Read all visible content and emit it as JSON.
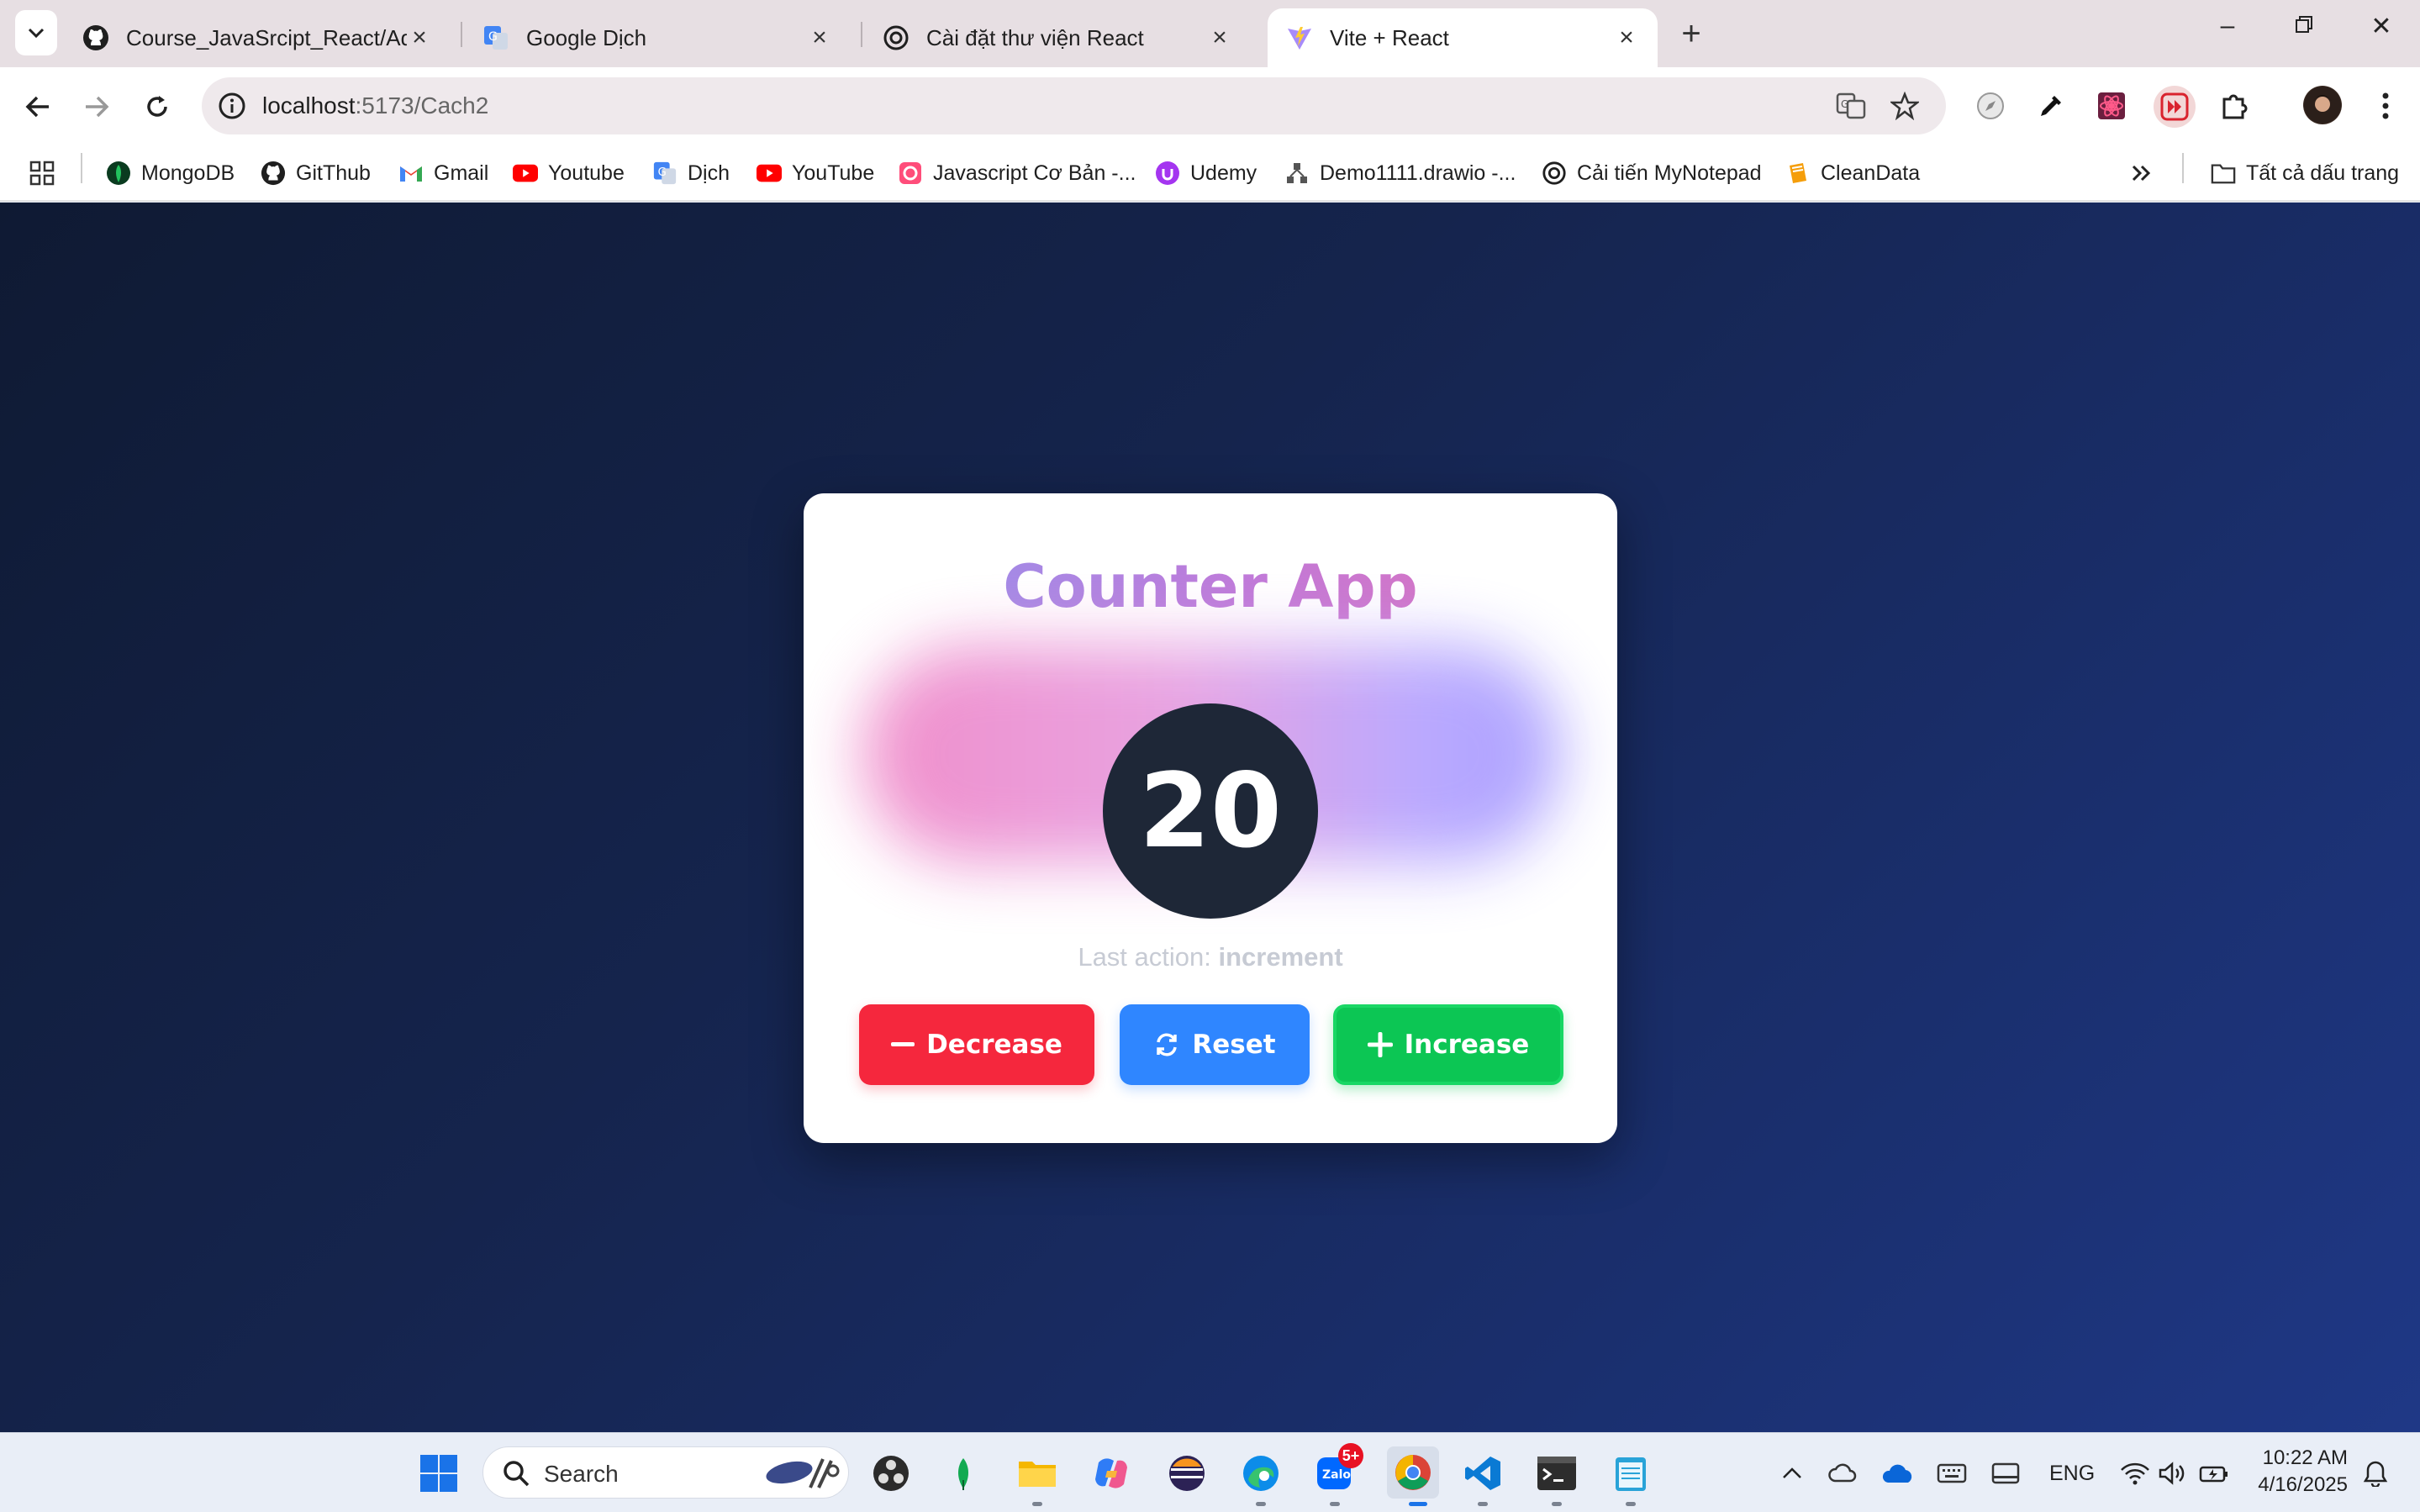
{
  "browser": {
    "tabs": [
      {
        "title": "Course_JavaSrcipt_React/Admin",
        "icon": "github-icon"
      },
      {
        "title": "Google Dịch",
        "icon": "google-translate-icon"
      },
      {
        "title": "Cài đặt thư viện React",
        "icon": "openai-icon"
      },
      {
        "title": "Vite + React",
        "icon": "vite-icon",
        "active": true
      }
    ],
    "url_host": "localhost",
    "url_path": ":5173/Cach2",
    "bookmarks": [
      {
        "label": "MongoDB",
        "icon": "mongodb-icon"
      },
      {
        "label": "GitThub",
        "icon": "github-icon"
      },
      {
        "label": "Gmail",
        "icon": "gmail-icon"
      },
      {
        "label": "Youtube",
        "icon": "youtube-icon"
      },
      {
        "label": "Dịch",
        "icon": "google-translate-icon"
      },
      {
        "label": "YouTube",
        "icon": "youtube-icon"
      },
      {
        "label": "Javascript Cơ Bản -...",
        "icon": "bookmark-icon"
      },
      {
        "label": "Udemy",
        "icon": "udemy-icon"
      },
      {
        "label": "Demo1111.drawio -...",
        "icon": "drawio-icon"
      },
      {
        "label": "Cải tiến MyNotepad",
        "icon": "openai-icon"
      },
      {
        "label": "CleanData",
        "icon": "bookmark-icon"
      }
    ],
    "all_bookmarks_label": "Tất cả dấu trang"
  },
  "app": {
    "title": "Counter App",
    "count": "20",
    "last_action_label": "Last action:",
    "last_action_value": "increment",
    "buttons": {
      "decrease": "Decrease",
      "reset": "Reset",
      "increase": "Increase"
    },
    "colors": {
      "decrease": "#f5273d",
      "reset": "#2f86ff",
      "increase": "#0cc654",
      "counter_bg": "#1e2737"
    }
  },
  "taskbar": {
    "search_label": "Search",
    "zalo_badge": "5+",
    "language": "ENG",
    "time": "10:22 AM",
    "date": "4/16/2025"
  }
}
